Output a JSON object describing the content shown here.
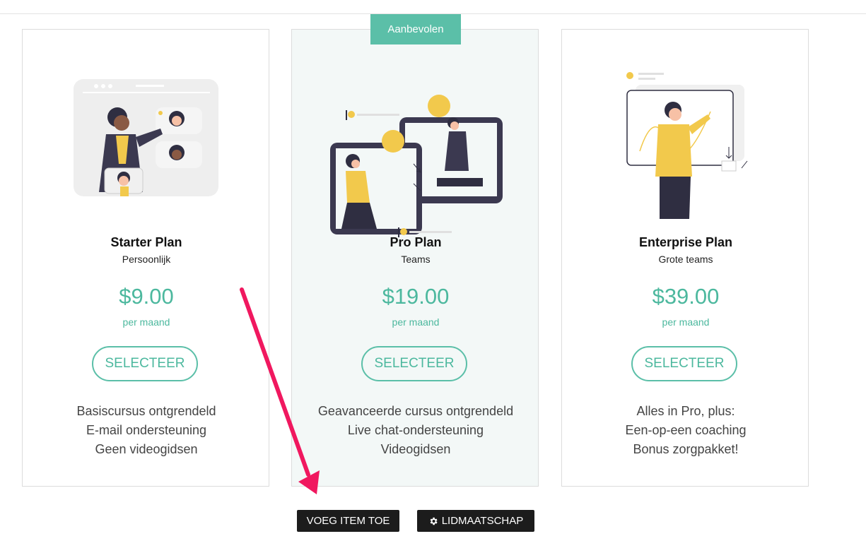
{
  "badge": "Aanbevolen",
  "plans": [
    {
      "name": "Starter Plan",
      "subtitle": "Persoonlijk",
      "price": "$9.00",
      "period": "per maand",
      "button": "SELECTEER",
      "features": [
        "Basiscursus ontgrendeld",
        "E-mail ondersteuning",
        "Geen videogidsen"
      ]
    },
    {
      "name": "Pro Plan",
      "subtitle": "Teams",
      "price": "$19.00",
      "period": "per maand",
      "button": "SELECTEER",
      "features": [
        "Geavanceerde cursus ontgrendeld",
        "Live chat-ondersteuning",
        "Videogidsen"
      ]
    },
    {
      "name": "Enterprise Plan",
      "subtitle": "Grote teams",
      "price": "$39.00",
      "period": "per maand",
      "button": "SELECTEER",
      "features": [
        "Alles in Pro, plus:",
        "Een-op-een coaching",
        "Bonus zorgpakket!"
      ]
    }
  ],
  "actions": {
    "add_item": "VOEG ITEM TOE",
    "membership": "LIDMAATSCHAP",
    "membership_icon": "gear-icon"
  },
  "colors": {
    "accent": "#5bbfa8",
    "featured_bg": "#f3f8f7",
    "annotation_arrow": "#f0185f",
    "dark_button": "#1c1c1c"
  }
}
